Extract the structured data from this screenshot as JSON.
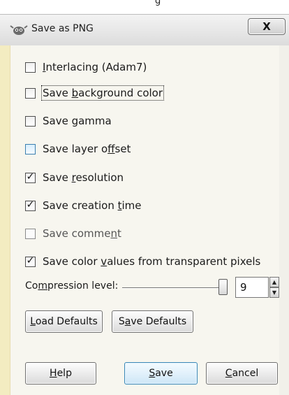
{
  "window": {
    "title": "Save as PNG",
    "close_label": "X",
    "top_cutoff_text": "g"
  },
  "options": [
    {
      "label_pre": "",
      "label_u": "I",
      "label_post": "nterlacing (Adam7)",
      "checked": false
    },
    {
      "label_pre": "Save ",
      "label_u": "b",
      "label_post": "ackground color",
      "checked": false
    },
    {
      "label_pre": "Save gamma",
      "label_u": "",
      "label_post": "",
      "checked": false
    },
    {
      "label_pre": "Save layer o",
      "label_u": "f",
      "label_post": "fset",
      "checked": false
    },
    {
      "label_pre": "Save ",
      "label_u": "r",
      "label_post": "esolution",
      "checked": true
    },
    {
      "label_pre": "Save creation ",
      "label_u": "t",
      "label_post": "ime",
      "checked": true
    },
    {
      "label_pre": "Save comme",
      "label_u": "n",
      "label_post": "t",
      "checked": false
    },
    {
      "label_pre": "Save color ",
      "label_u": "v",
      "label_post": "alues from transparent pixels",
      "checked": true
    }
  ],
  "compression": {
    "label_pre": "Co",
    "label_u": "m",
    "label_post": "pression level:",
    "value": "9",
    "min": 0,
    "max": 9
  },
  "buttons": {
    "load_defaults_u": "L",
    "load_defaults_rest": "oad Defaults",
    "save_defaults_pre": "S",
    "save_defaults_u": "a",
    "save_defaults_rest": "ve Defaults",
    "help_u": "H",
    "help_rest": "elp",
    "save_u": "S",
    "save_rest": "ave",
    "cancel_u": "C",
    "cancel_rest": "ancel"
  }
}
